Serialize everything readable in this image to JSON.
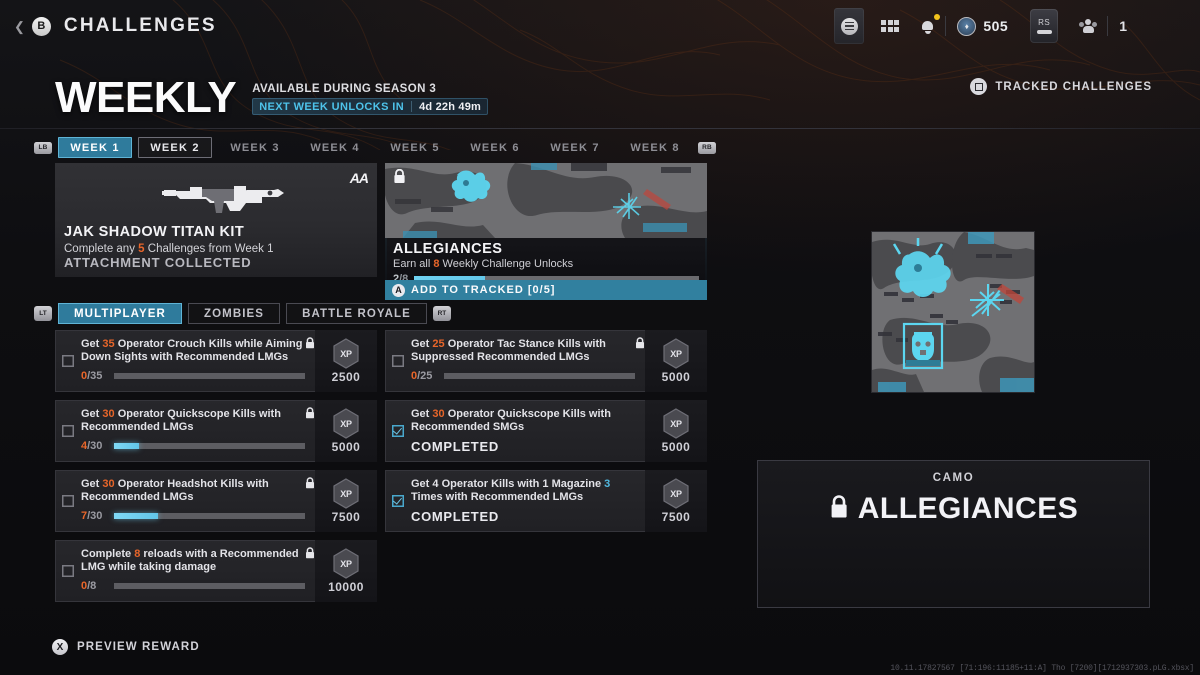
{
  "header": {
    "back_button": "B",
    "title": "CHALLENGES",
    "icons": {
      "menu": "menu-disc-icon",
      "grid": "grid-icon",
      "bell": "bell-icon",
      "currency": "currency-icon",
      "squad": "squad-icon"
    },
    "currency_value": "505",
    "rs_key": "RS",
    "squad_count": "1"
  },
  "hero": {
    "title": "WEEKLY",
    "available": "AVAILABLE DURING SEASON 3",
    "unlock_label": "NEXT WEEK UNLOCKS IN",
    "unlock_time": "4d 22h 49m",
    "tracked_button": "TRACKED CHALLENGES"
  },
  "week_tabs": {
    "left_bumper": "LB",
    "right_bumper": "RB",
    "items": [
      {
        "label": "WEEK 1",
        "state": "active"
      },
      {
        "label": "WEEK 2",
        "state": "focus"
      },
      {
        "label": "WEEK 3",
        "state": "idle"
      },
      {
        "label": "WEEK 4",
        "state": "idle"
      },
      {
        "label": "WEEK 5",
        "state": "idle"
      },
      {
        "label": "WEEK 6",
        "state": "idle"
      },
      {
        "label": "WEEK 7",
        "state": "idle"
      },
      {
        "label": "WEEK 8",
        "state": "idle"
      }
    ]
  },
  "reward_kit": {
    "title": "JAK SHADOW TITAN KIT",
    "sub_pre": "Complete any ",
    "sub_num": "5",
    "sub_post": " Challenges from Week 1",
    "status": "ATTACHMENT COLLECTED",
    "badge": "AA"
  },
  "reward_camo": {
    "name": "ALLEGIANCES",
    "desc_pre": "Earn all ",
    "desc_num": "8",
    "desc_post": " Weekly Challenge Unlocks",
    "progress_current": "2",
    "progress_total": "/8",
    "progress_pct": 25,
    "cta_button": "A",
    "cta_label": "ADD TO TRACKED [0/5]"
  },
  "mode_tabs": {
    "left_trigger": "LT",
    "right_trigger": "RT",
    "items": [
      {
        "label": "MULTIPLAYER",
        "state": "active"
      },
      {
        "label": "ZOMBIES",
        "state": "idle"
      },
      {
        "label": "BATTLE ROYALE",
        "state": "idle"
      }
    ]
  },
  "challenges_left": [
    {
      "text_pre": "Get ",
      "text_num": "35",
      "num_color": "orange",
      "text_post": " Operator Crouch Kills while Aiming Down Sights with Recommended LMGs",
      "current": "0",
      "total": "/35",
      "pct": 0,
      "xp": "2500",
      "xp_badge": "XP",
      "locked": true,
      "completed": false
    },
    {
      "text_pre": "Get ",
      "text_num": "30",
      "num_color": "orange",
      "text_post": " Operator Quickscope Kills with Recommended LMGs",
      "current": "4",
      "total": "/30",
      "pct": 13,
      "xp": "5000",
      "xp_badge": "XP",
      "locked": true,
      "completed": false
    },
    {
      "text_pre": "Get ",
      "text_num": "30",
      "num_color": "orange",
      "text_post": " Operator Headshot Kills with Recommended LMGs",
      "current": "7",
      "total": "/30",
      "pct": 23,
      "xp": "7500",
      "xp_badge": "XP",
      "locked": true,
      "completed": false
    },
    {
      "text_pre": "Complete ",
      "text_num": "8",
      "num_color": "orange",
      "text_post": " reloads with a Recommended LMG while taking damage",
      "current": "0",
      "total": "/8",
      "pct": 0,
      "xp": "10000",
      "xp_badge": "XP",
      "locked": true,
      "completed": false
    }
  ],
  "challenges_right": [
    {
      "text_pre": "Get ",
      "text_num": "25",
      "num_color": "orange",
      "text_post": " Operator Tac Stance Kills with Suppressed Recommended LMGs",
      "current": "0",
      "total": "/25",
      "pct": 0,
      "xp": "5000",
      "xp_badge": "XP",
      "locked": true,
      "completed": false
    },
    {
      "text_pre": "Get ",
      "text_num": "30",
      "num_color": "orange",
      "text_post": " Operator Quickscope Kills with Recommended SMGs",
      "completed_label": "COMPLETED",
      "xp": "5000",
      "xp_badge": "XP",
      "locked": false,
      "completed": true
    },
    {
      "text_pre": "Get 4 Operator Kills with 1 Magazine ",
      "text_num": "3",
      "num_color": "blue",
      "text_post": " Times with Recommended LMGs",
      "completed_label": "COMPLETED",
      "xp": "7500",
      "xp_badge": "XP",
      "locked": false,
      "completed": true
    }
  ],
  "preview": {
    "kicker": "CAMO",
    "name": "ALLEGIANCES",
    "image_name": "camo-swatch-allegiances"
  },
  "footer": {
    "preview_button": "X",
    "preview_label": "PREVIEW REWARD",
    "debug": "10.11.17827567 [71:196:11185+11:A] Tho [7200][1712937303.pLG.xbsx]"
  },
  "colors": {
    "accent_cyan": "#2f7b9c",
    "accent_orange": "#e8662a",
    "bar_fill": "#62c5e8"
  }
}
